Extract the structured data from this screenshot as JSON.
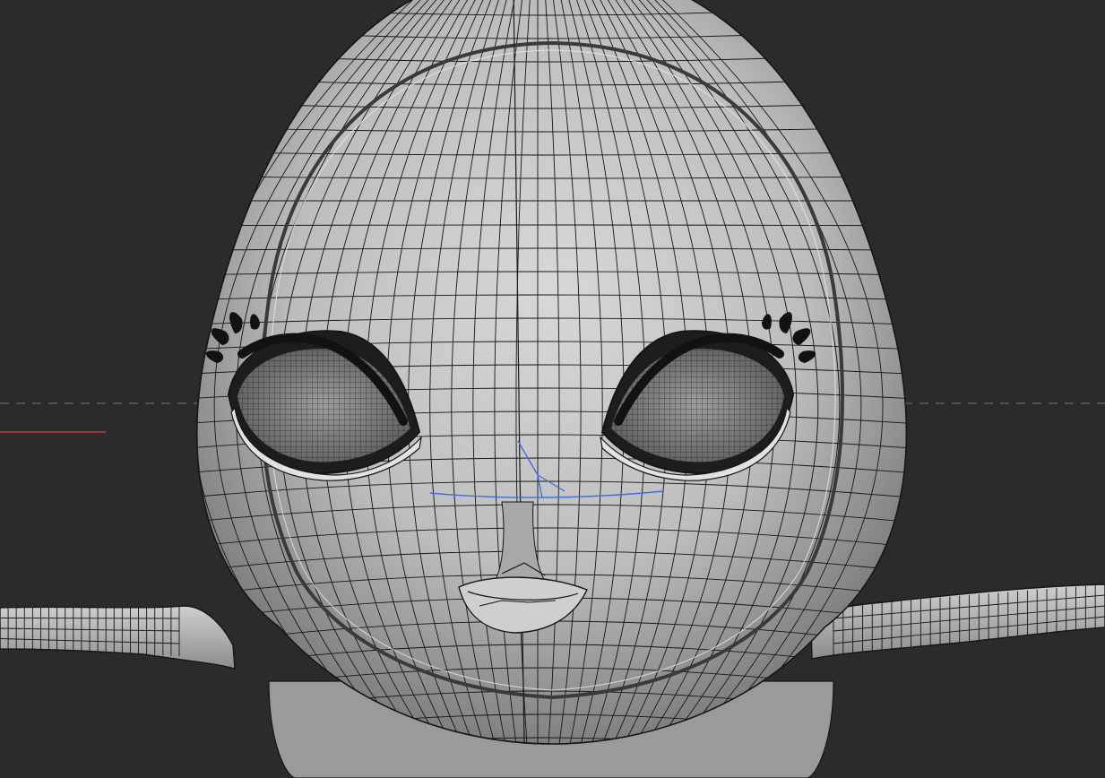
{
  "viewport": {
    "background": "#2b2b2b",
    "shading": "gray",
    "overlay": "wireframe"
  },
  "colors": {
    "background": "#2b2b2b",
    "mesh_light": "#d4d4d4",
    "mesh_mid": "#a9a9a9",
    "mesh_dark": "#6d6d6d",
    "wire": "#161616",
    "eye_grid": "#3a3a3a",
    "lash": "#121212",
    "axis_x": "#c23a3a",
    "axis_dashed": "#6a6a6a",
    "selection": "#3f6fd8"
  },
  "icons": [
    "viewport-icon"
  ],
  "model": {
    "name": "",
    "mode": "object"
  }
}
